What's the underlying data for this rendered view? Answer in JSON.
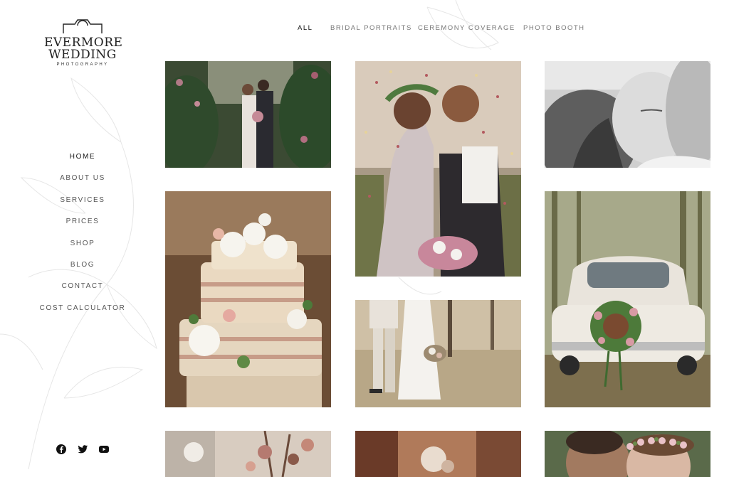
{
  "brand": {
    "line1": "EVERMORE",
    "line2": "WEDDING",
    "line3": "PHOTOGRAPHY"
  },
  "nav": {
    "items": [
      {
        "label": "HOME",
        "active": true
      },
      {
        "label": "ABOUT US"
      },
      {
        "label": "SERVICES"
      },
      {
        "label": "PRICES"
      },
      {
        "label": "SHOP"
      },
      {
        "label": "BLOG"
      },
      {
        "label": "CONTACT"
      },
      {
        "label": "COST CALCULATOR"
      }
    ]
  },
  "filters": {
    "tabs": [
      {
        "label": "ALL",
        "active": true
      },
      {
        "label": "BRIDAL PORTRAITS"
      },
      {
        "label": "CEREMONY COVERAGE"
      },
      {
        "label": "PHOTO BOOTH"
      }
    ]
  },
  "social": {
    "icons": [
      "facebook-icon",
      "twitter-icon",
      "youtube-icon"
    ]
  },
  "gallery": {
    "photos": [
      {
        "subject": "couple kissing in garden"
      },
      {
        "subject": "couple with confetti"
      },
      {
        "subject": "black and white close-up"
      },
      {
        "subject": "wedding cake with flowers"
      },
      {
        "subject": "couple walking with bouquet"
      },
      {
        "subject": "vintage wedding car"
      },
      {
        "subject": "table florals"
      },
      {
        "subject": "reception detail"
      },
      {
        "subject": "couple portrait with flower crown"
      }
    ]
  },
  "colors": {
    "text": "#2a2a2a",
    "muted": "#777777",
    "background": "#ffffff"
  }
}
